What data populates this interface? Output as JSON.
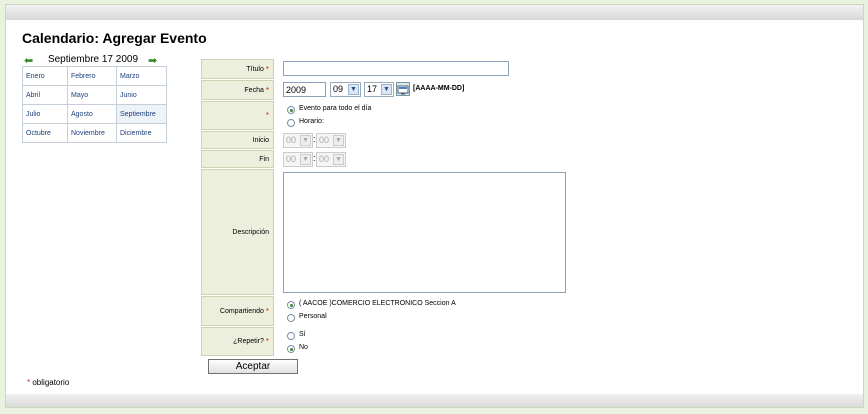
{
  "page": {
    "title": "Calendario: Agregar Evento"
  },
  "calendar": {
    "header": "Septiembre 17 2009",
    "prev_icon": "arrow-left-icon",
    "next_icon": "arrow-right-icon",
    "months": [
      [
        "Enero",
        "Febrero",
        "Marzo"
      ],
      [
        "Abril",
        "Mayo",
        "Junio"
      ],
      [
        "Julio",
        "Agosto",
        "Septiembre"
      ],
      [
        "Octubre",
        "Noviembre",
        "Diciembre"
      ]
    ],
    "current_month": "Septiembre"
  },
  "form": {
    "titulo": {
      "label": "Título",
      "value": ""
    },
    "fecha": {
      "label": "Fecha",
      "year": "2009",
      "month": "09",
      "day": "17",
      "format": "[AAAA-MM-DD]"
    },
    "time_mode": {
      "label": "",
      "options": [
        "Evento para todo el día",
        "Horario:"
      ],
      "selected": "Evento para todo el día"
    },
    "inicio": {
      "label": "Inicio",
      "hour": "00",
      "minute": "00"
    },
    "fin": {
      "label": "Fin",
      "hour": "00",
      "minute": "00"
    },
    "descripcion": {
      "label": "Descripción",
      "value": ""
    },
    "compartiendo": {
      "label": "Compartiendo",
      "options": [
        "( AACOE )COMERCIO ELECTRONICO Seccion A",
        "Personal"
      ],
      "selected": "( AACOE )COMERCIO ELECTRONICO Seccion A"
    },
    "repetir": {
      "label": "¿Repetir?",
      "options": [
        "Sí",
        "No"
      ],
      "selected": "No"
    },
    "submit_label": "Aceptar",
    "required_mark": "*"
  },
  "footnote": {
    "mark": "*",
    "text": "obligatorio"
  },
  "colors": {
    "accent": "#3c8a2c",
    "required": "#d22222",
    "label_bg": "#ecefdc",
    "link": "#1d3f7a"
  }
}
